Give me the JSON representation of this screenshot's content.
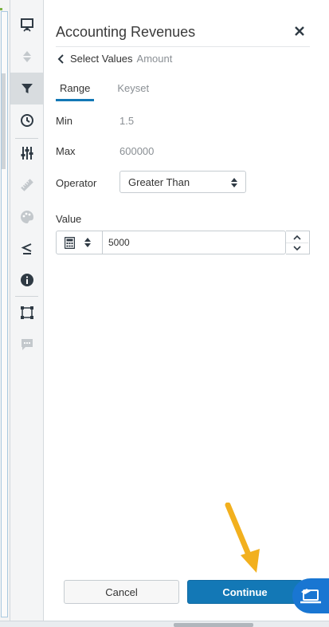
{
  "panel": {
    "title": "Accounting Revenues",
    "breadcrumb": {
      "label": "Select Values",
      "sub": "Amount"
    },
    "tabs": [
      {
        "label": "Range",
        "active": true
      },
      {
        "label": "Keyset",
        "active": false
      }
    ],
    "min": {
      "label": "Min",
      "value": "1.5"
    },
    "max": {
      "label": "Max",
      "value": "600000"
    },
    "operator": {
      "label": "Operator",
      "selected": "Greater Than"
    },
    "value": {
      "label": "Value",
      "current": "5000"
    },
    "buttons": {
      "cancel": "Cancel",
      "continue": "Continue"
    }
  },
  "rail": {
    "items": [
      "presentation-icon",
      "sort-icon",
      "filter-icon",
      "clock-icon",
      "sliders-icon",
      "ruler-icon",
      "palette-icon",
      "less-equal-icon",
      "info-icon",
      "selection-icon",
      "comment-icon"
    ],
    "active": "filter-icon"
  },
  "colors": {
    "accent": "#1378b6",
    "arrow": "#f2b01e",
    "help": "#1976d2"
  }
}
